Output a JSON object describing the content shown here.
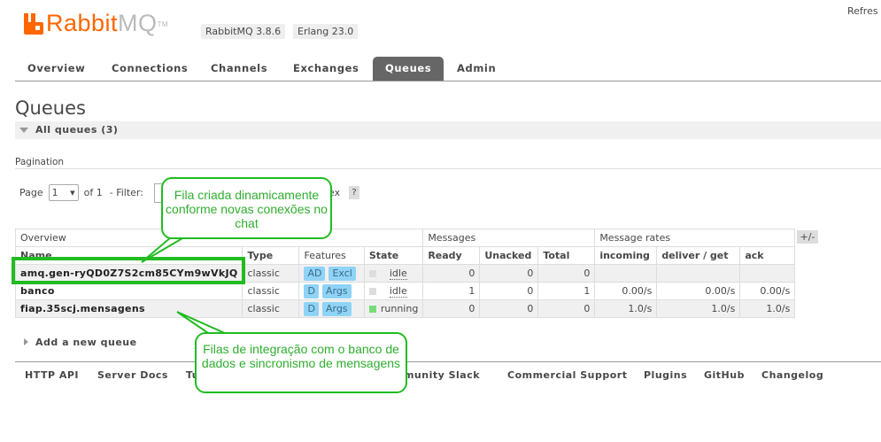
{
  "brand": {
    "rabbit": "Rabbit",
    "mq": "MQ",
    "tm": "TM"
  },
  "version_badges": [
    "RabbitMQ 3.8.6",
    "Erlang 23.0"
  ],
  "refresh_label": "Refres",
  "nav_tabs": [
    "Overview",
    "Connections",
    "Channels",
    "Exchanges",
    "Queues",
    "Admin"
  ],
  "active_tab": "Queues",
  "page_title": "Queues",
  "section_label": "All queues (3)",
  "pagination": {
    "label": "Pagination",
    "page_label": "Page",
    "page_value": "1",
    "of_label": "of 1",
    "filter_label": "- Filter:",
    "regex_partial": "ex",
    "help": "?"
  },
  "table": {
    "group_headers": [
      "Overview",
      "Messages",
      "Message rates"
    ],
    "plus_minus": "+/-",
    "columns": [
      "Name",
      "Type",
      "Features",
      "State",
      "Ready",
      "Unacked",
      "Total",
      "incoming",
      "deliver / get",
      "ack"
    ],
    "rows": [
      {
        "name": "amq.gen-ryQD0Z7S2cm85CYm9wVkJQ",
        "type": "classic",
        "features": [
          "AD",
          "Excl"
        ],
        "state": "idle",
        "ready": "0",
        "unacked": "0",
        "total": "0",
        "incoming": "",
        "deliver": "",
        "ack": ""
      },
      {
        "name": "banco",
        "type": "classic",
        "features": [
          "D",
          "Args"
        ],
        "state": "idle",
        "ready": "1",
        "unacked": "0",
        "total": "1",
        "incoming": "0.00/s",
        "deliver": "0.00/s",
        "ack": "0.00/s"
      },
      {
        "name": "fiap.35scj.mensagens",
        "type": "classic",
        "features": [
          "D",
          "Args"
        ],
        "state": "running",
        "ready": "0",
        "unacked": "0",
        "total": "0",
        "incoming": "1.0/s",
        "deliver": "1.0/s",
        "ack": "1.0/s"
      }
    ]
  },
  "add_queue": "Add a new queue",
  "footer_links": [
    "HTTP API",
    "Server Docs",
    "Tu",
    "mmunity Slack",
    "Commercial Support",
    "Plugins",
    "GitHub",
    "Changelog"
  ],
  "callouts": {
    "top": "Fila criada dinamicamente conforme novas conexões no chat",
    "bottom": "Filas de integração com o banco de dados e sincronismo de mensagens"
  },
  "colors": {
    "brand_orange": "#ff6600",
    "callout_green": "#22bb22",
    "feature_blue": "#8fd3f6",
    "running_green": "#77dd77",
    "idle_grey": "#dddddd"
  }
}
